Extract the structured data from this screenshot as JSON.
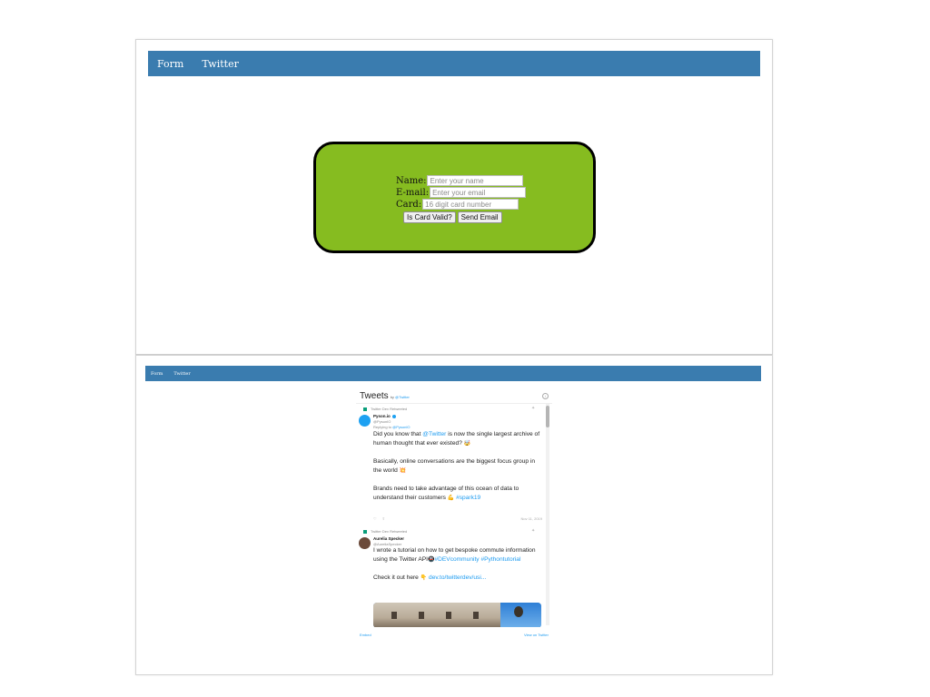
{
  "top_panel": {
    "nav": [
      {
        "label": "Form"
      },
      {
        "label": "Twitter"
      }
    ],
    "form": {
      "name_label": "Name:",
      "name_placeholder": "Enter your name",
      "email_label": "E-mail:",
      "email_placeholder": "Enter your email",
      "card_label": "Card:",
      "card_placeholder": "16 digit card number",
      "validate_button": "Is Card Valid?",
      "send_button": "Send Email"
    }
  },
  "bottom_panel": {
    "nav": [
      {
        "label": "Form"
      },
      {
        "label": "Twitter"
      }
    ],
    "twitter": {
      "title": "Tweets",
      "by_prefix": "by",
      "by_handle": "@Twitter",
      "tweets": [
        {
          "context": "Twitter Dev Retweeted",
          "author": "Pyson.io",
          "handle": "@PysonIO",
          "reply_prefix": "Replying to",
          "reply_handle": "@PysonIO",
          "text_1": "Did you know that",
          "mention": "@Twitter",
          "text_2": "is now the single largest archive of human thought that ever existed?",
          "emoji_1": "🤯",
          "para_2": "Basically, online conversations are the biggest focus group in the world",
          "emoji_2": "💥",
          "para_3": "Brands need to take advantage of this ocean of data to understand their customers",
          "emoji_3": "💪",
          "hashtag": "#spark19",
          "date": "Nov 11, 2019"
        },
        {
          "context": "Twitter Dev Retweeted",
          "author": "Aurelia Specker",
          "handle": "@AureliaSpecker",
          "text_1": "I wrote a tutorial on how to get bespoke commute information using the Twitter API",
          "emoji_1": "🚇",
          "hashtag_1": "#DEVcommunity",
          "hashtag_2": "#Pythontutorial",
          "para_2": "Check it out here",
          "emoji_2": "👇",
          "link": "dev.to/twitterdev/usi..."
        }
      ],
      "footer_left": "Embed",
      "footer_right": "View on Twitter"
    }
  },
  "colors": {
    "navbar": "#3a7caf",
    "card_green": "#86bc20",
    "link_blue": "#1d9bf0"
  }
}
